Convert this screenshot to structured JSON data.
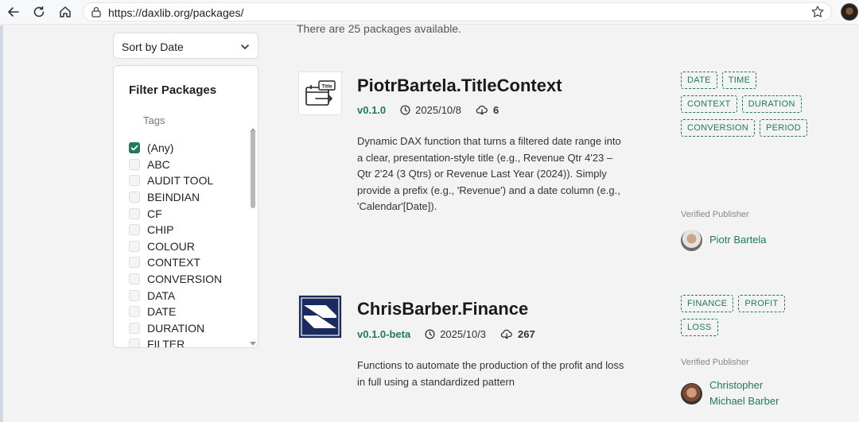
{
  "browser": {
    "url": "https://daxlib.org/packages/"
  },
  "sidebar": {
    "sort_label": "Sort by Date",
    "filter_title": "Filter Packages",
    "tags_label": "Tags",
    "tags": [
      {
        "label": "(Any)",
        "checked": true
      },
      {
        "label": "ABC",
        "checked": false
      },
      {
        "label": "AUDIT TOOL",
        "checked": false
      },
      {
        "label": "BEINDIAN",
        "checked": false
      },
      {
        "label": "CF",
        "checked": false
      },
      {
        "label": "CHIP",
        "checked": false
      },
      {
        "label": "COLOUR",
        "checked": false
      },
      {
        "label": "CONTEXT",
        "checked": false
      },
      {
        "label": "CONVERSION",
        "checked": false
      },
      {
        "label": "DATA",
        "checked": false
      },
      {
        "label": "DATE",
        "checked": false
      },
      {
        "label": "DURATION",
        "checked": false
      },
      {
        "label": "FILTER",
        "checked": false
      }
    ]
  },
  "main": {
    "count_text": "There are 25 packages available.",
    "packages": [
      {
        "icon": "title-context-icon",
        "title": "PiotrBartela.TitleContext",
        "version": "v0.1.0",
        "date": "2025/10/8",
        "downloads": "6",
        "description": "Dynamic DAX function that turns a filtered date range into a clear, presentation-style title (e.g., Revenue Qtr 4'23 – Qtr 2'24 (3 Qtrs) or Revenue Last Year (2024)). Simply provide a prefix (e.g., 'Revenue') and a date column (e.g., 'Calendar'[Date]).",
        "tags": [
          "DATE",
          "TIME",
          "CONTEXT",
          "DURATION",
          "CONVERSION",
          "PERIOD"
        ],
        "verified_label": "Verified Publisher",
        "publisher": "Piotr Bartela"
      },
      {
        "icon": "finance-logo-icon",
        "title": "ChrisBarber.Finance",
        "version": "v0.1.0-beta",
        "date": "2025/10/3",
        "downloads": "267",
        "description": "Functions to automate the production of the profit and loss in full using a standardized pattern",
        "tags": [
          "FINANCE",
          "PROFIT",
          "LOSS"
        ],
        "verified_label": "Verified Publisher",
        "publisher": "Christopher Michael Barber"
      }
    ]
  },
  "colors": {
    "accent": "#1f7a5c",
    "background": "#f3f3f3"
  }
}
